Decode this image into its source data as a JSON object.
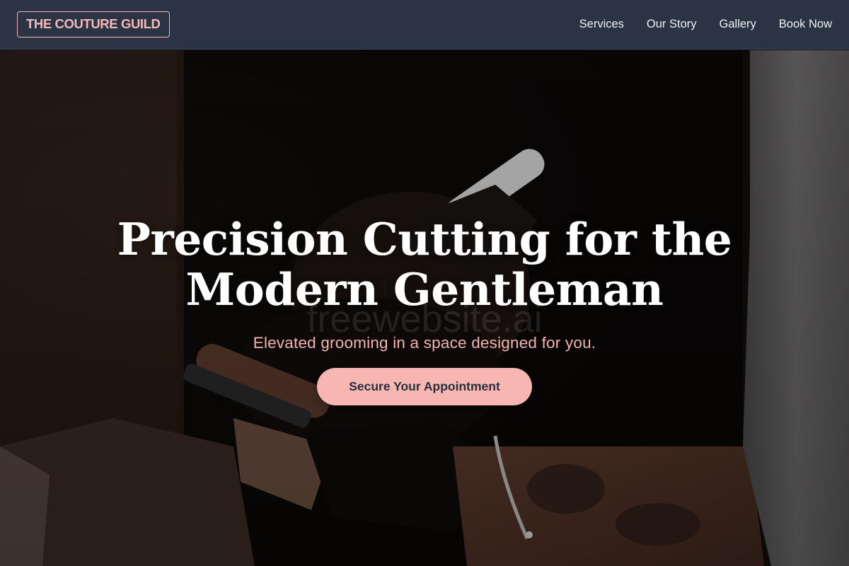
{
  "header": {
    "logo_text": "THE COUTURE GUILD",
    "nav": [
      {
        "label": "Services"
      },
      {
        "label": "Our Story"
      },
      {
        "label": "Gallery"
      },
      {
        "label": "Book Now"
      }
    ]
  },
  "hero": {
    "title_line1": "Precision Cutting for the",
    "title_line2": "Modern Gentleman",
    "watermark": "freewebsite.ai",
    "subtitle": "Elevated grooming in a space designed for you.",
    "cta_label": "Secure Your Appointment"
  },
  "colors": {
    "header_bg": "#2a3444",
    "accent_pink": "#f7b6b1",
    "cta_text": "#26303f",
    "hero_title": "#ffffff"
  },
  "icons": {
    "background": "barber-trimming-beard-photo"
  }
}
